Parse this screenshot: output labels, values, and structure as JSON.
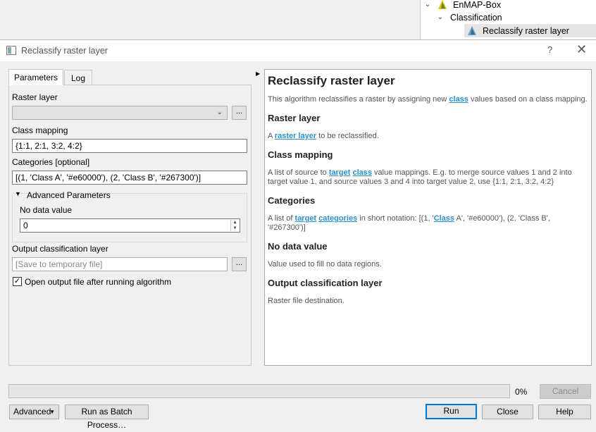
{
  "tree": {
    "items": [
      {
        "label": "EnMAP-Box",
        "expanded": true
      },
      {
        "label": "Classification",
        "expanded": true
      },
      {
        "label": "Reclassify raster layer",
        "selected": true
      }
    ]
  },
  "dialog": {
    "title": "Reclassify raster layer",
    "help_glyph": "?",
    "close_glyph": "✕",
    "tabs": [
      {
        "label": "Parameters",
        "active": true
      },
      {
        "label": "Log",
        "active": false
      }
    ],
    "params": {
      "raster_layer_label": "Raster layer",
      "raster_layer_value": "",
      "browse_label": "...",
      "class_mapping_label": "Class mapping",
      "class_mapping_value": "{1:1, 2:1, 3:2, 4:2}",
      "categories_label": "Categories [optional]",
      "categories_value": "[(1, 'Class A', '#e60000'), (2, 'Class B', '#267300')]",
      "advanced_group_label": "Advanced Parameters",
      "no_data_label": "No data value",
      "no_data_value": "0",
      "output_label": "Output classification layer",
      "output_placeholder": "[Save to temporary file]",
      "output_browse_label": "...",
      "open_output_label": "Open output file after running algorithm",
      "open_output_checked": true
    },
    "help": {
      "title": "Reclassify raster layer",
      "intro_pre": "This algorithm reclassifies a raster by assigning new ",
      "intro_link": "class",
      "intro_post": " values based on a class mapping.",
      "sections": {
        "raster_layer": {
          "heading": "Raster layer",
          "pre": "A ",
          "link": "raster layer",
          "post": " to be reclassified."
        },
        "class_mapping": {
          "heading": "Class mapping",
          "pre": "A list of source to ",
          "link1": "target",
          "mid": " ",
          "link2": "class",
          "post": " value mappings. E.g. to merge source values 1 and 2 into target value 1, and source values 3 and 4 into target value 2, use {1:1, 2:1, 3:2, 4:2}"
        },
        "categories": {
          "heading": "Categories",
          "pre": "A list of ",
          "link1": "target",
          "mid": " ",
          "link2": "categories",
          "mid2": " in short notation: [(1, '",
          "link3": "Class",
          "post": " A', '#e60000'), (2, 'Class B', '#267300')]"
        },
        "no_data": {
          "heading": "No data value",
          "text": "Value used to fill no data regions."
        },
        "output": {
          "heading": "Output classification layer",
          "text": "Raster file destination."
        }
      }
    },
    "progress": {
      "percent_text": "0%",
      "fraction": 0.0
    },
    "buttons": {
      "cancel": "Cancel",
      "advanced": "Advanced",
      "batch": "Run as Batch Process…",
      "run": "Run",
      "close": "Close",
      "help": "Help"
    }
  },
  "colors": {
    "link": "#2a8fc8",
    "default_button_border": "#0078d7"
  }
}
